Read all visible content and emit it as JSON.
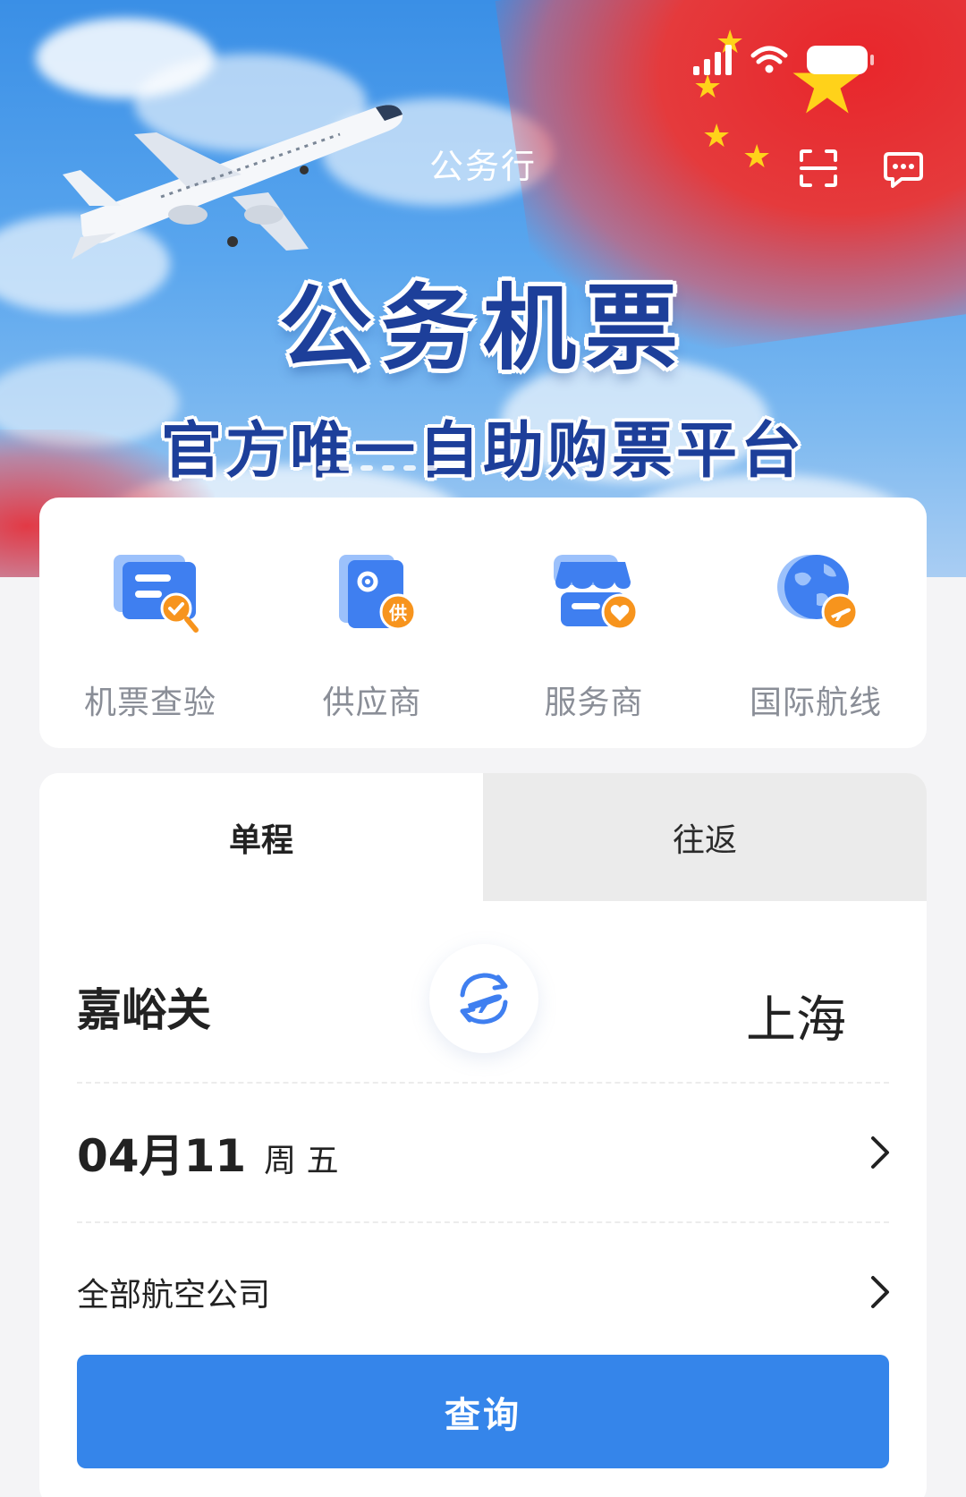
{
  "app": {
    "title": "公务行"
  },
  "banner": {
    "headline": "公务机票",
    "subhead": "官方唯一自助购票平台"
  },
  "header_actions": [
    {
      "icon": "scan-icon"
    },
    {
      "icon": "message-icon"
    }
  ],
  "quick_entries": [
    {
      "label": "机票查验",
      "icon": "ticket-check-icon"
    },
    {
      "label": "供应商",
      "icon": "supplier-icon"
    },
    {
      "label": "服务商",
      "icon": "service-provider-icon"
    },
    {
      "label": "国际航线",
      "icon": "international-route-icon"
    }
  ],
  "search": {
    "tabs": [
      {
        "label": "单程",
        "active": true
      },
      {
        "label": "往返",
        "active": false
      }
    ],
    "from_city": "嘉峪关",
    "to_city": "上海",
    "date": {
      "day": "04月11",
      "weekday": "周 五"
    },
    "airline": "全部航空公司",
    "submit_label": "查询"
  },
  "colors": {
    "primary": "#3585ea",
    "headline": "#1d3f9a",
    "icon_blue": "#3f7ff0",
    "icon_orange": "#f7941d"
  }
}
